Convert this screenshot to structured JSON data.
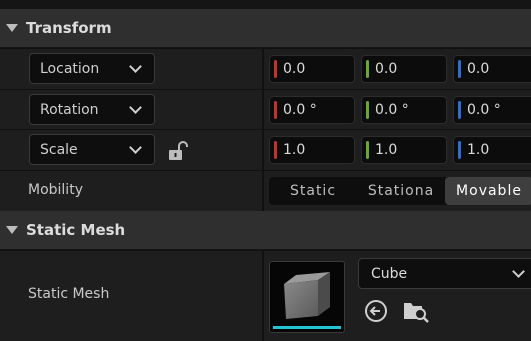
{
  "transform": {
    "header": "Transform",
    "location": {
      "mode": "Location",
      "x": "0.0",
      "y": "0.0",
      "z": "0.0"
    },
    "rotation": {
      "mode": "Rotation",
      "x": "0.0 °",
      "y": "0.0 °",
      "z": "0.0 °"
    },
    "scale": {
      "mode": "Scale",
      "x": "1.0",
      "y": "1.0",
      "z": "1.0",
      "lock_icon": "unlocked-padlock-icon"
    },
    "mobility": {
      "label": "Mobility",
      "options": [
        "Static",
        "Stationa",
        "Movable"
      ],
      "selected": "Movable"
    }
  },
  "static_mesh": {
    "header": "Static Mesh",
    "label": "Static Mesh",
    "value": "Cube",
    "icons": [
      "use-selected-asset-icon",
      "browse-asset-icon"
    ],
    "thumbnail_accent": "#23c3d4"
  },
  "colors": {
    "x_axis": "#c5312b",
    "y_axis": "#6aa82f",
    "z_axis": "#2f6fd2",
    "panel_bg": "#1e1e1e",
    "header_bg": "#2f2f2f"
  }
}
